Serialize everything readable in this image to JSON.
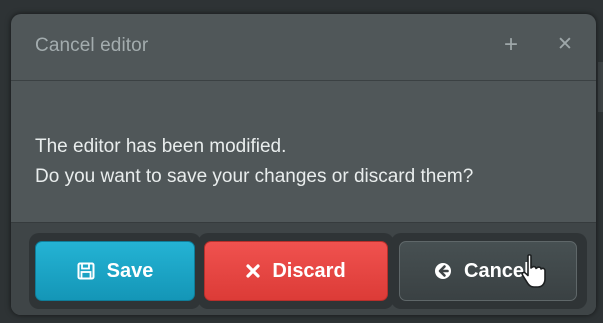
{
  "dialog": {
    "title": "Cancel editor",
    "icons": {
      "add": "plus-icon",
      "close": "close-icon"
    },
    "message_lines": [
      "The editor has been modified.",
      "Do you want to save your changes or discard them?"
    ]
  },
  "buttons": {
    "save": {
      "label": "Save",
      "icon": "floppy-disk-icon",
      "color": "#1aa3c4"
    },
    "discard": {
      "label": "Discard",
      "icon": "x-icon",
      "color": "#e5423f"
    },
    "cancel": {
      "label": "Cancel",
      "icon": "arrow-circle-left-icon",
      "color": "#424a4c"
    }
  }
}
